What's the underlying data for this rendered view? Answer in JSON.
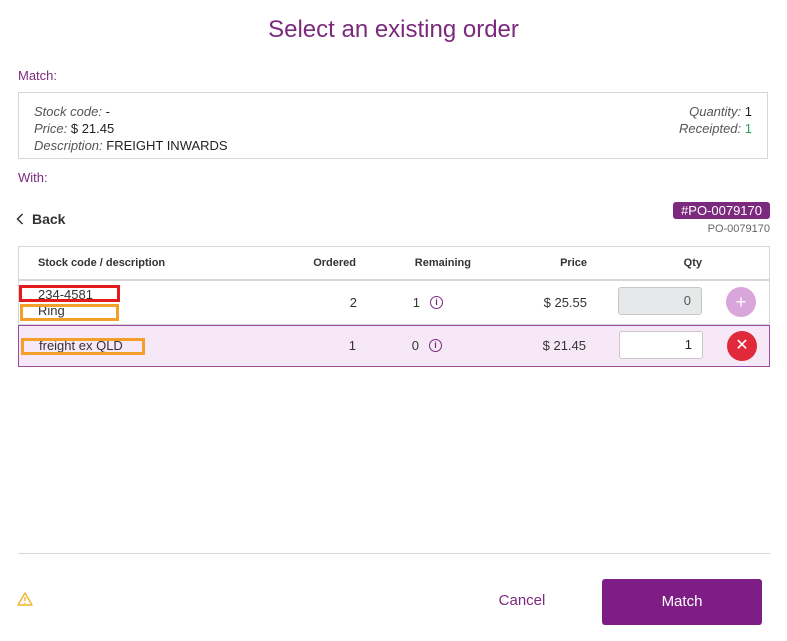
{
  "title": "Select an existing order",
  "match_label": "Match:",
  "with_label": "With:",
  "match_box": {
    "stock_code_label": "Stock code:",
    "stock_code_value": "-",
    "price_label": "Price:",
    "price_value": "$ 21.45",
    "description_label": "Description:",
    "description_value": "FREIGHT INWARDS",
    "quantity_label": "Quantity:",
    "quantity_value": "1",
    "receipted_label": "Receipted:",
    "receipted_value": "1"
  },
  "back_label": "Back",
  "po_badge": "#PO-0079170",
  "po_sub": "PO-0079170",
  "table": {
    "headers": {
      "code": "Stock code / description",
      "ordered": "Ordered",
      "remaining": "Remaining",
      "price": "Price",
      "qty": "Qty"
    },
    "rows": [
      {
        "code": "234-4581",
        "description": "Ring",
        "ordered": "2",
        "remaining": "1",
        "price": "$ 25.55",
        "qty": "0",
        "action_icon": "plus-icon"
      },
      {
        "code": "",
        "description": "freight ex QLD",
        "ordered": "1",
        "remaining": "0",
        "price": "$ 21.45",
        "qty": "1",
        "action_icon": "close-icon"
      }
    ]
  },
  "footer": {
    "cancel_label": "Cancel",
    "match_label": "Match",
    "warning_icon": "warning-icon"
  },
  "colors": {
    "brand": "#7b2a7e",
    "highlight_red": "#e41b1b",
    "highlight_orange": "#f59f2b",
    "remove_red": "#e0293a",
    "receipted_green": "#2e9e5b"
  }
}
